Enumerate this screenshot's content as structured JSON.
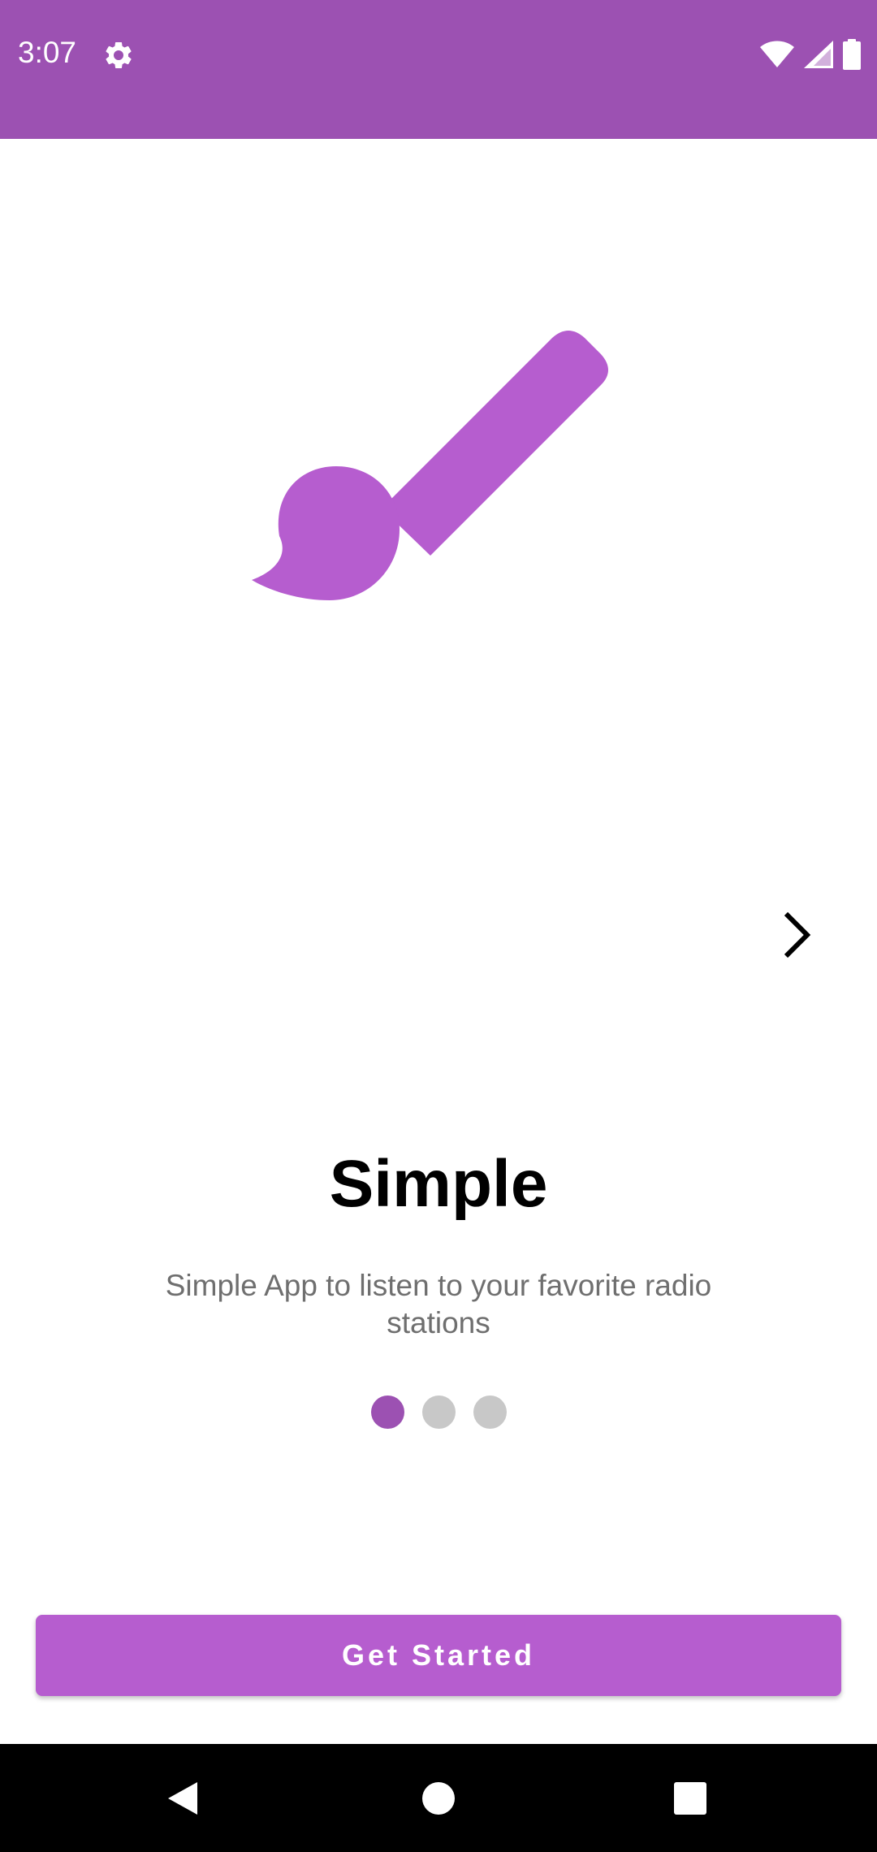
{
  "status_bar": {
    "time": "3:07",
    "icons": [
      "settings-gear-icon",
      "wifi-icon",
      "cell-signal-icon",
      "battery-icon"
    ],
    "background": "#9c51b2"
  },
  "slide": {
    "illustration_icon": "paint-brush-icon",
    "title": "Simple",
    "description": "Simple App to listen to your favorite radio stations",
    "next_icon": "chevron-right-icon",
    "page_indicator": {
      "total": 3,
      "active_index": 0
    }
  },
  "actions": {
    "get_started_label": "Get Started"
  },
  "nav_bar": {
    "buttons": [
      "back-triangle-icon",
      "home-circle-icon",
      "recents-square-icon"
    ]
  },
  "colors": {
    "primary": "#9c51b2",
    "accent": "#b65dcf",
    "dot_inactive": "#c8c8c8",
    "description_text": "#6f6f6f"
  }
}
